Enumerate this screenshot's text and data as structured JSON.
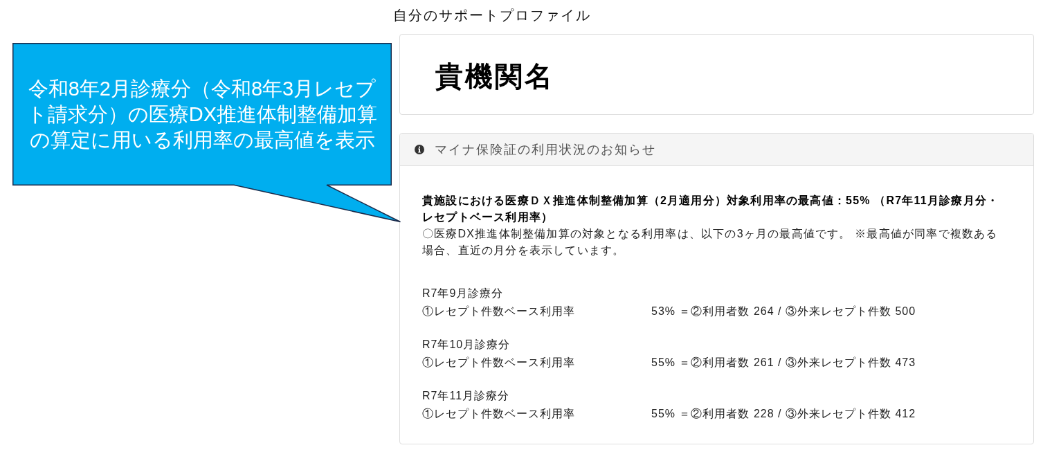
{
  "page_title": "自分のサポートプロファイル",
  "institution_card": {
    "name": "貴機関名"
  },
  "notice_panel": {
    "header": "マイナ保険証の利用状況のお知らせ",
    "headline": "貴施設における医療ＤＸ推進体制整備加算（2月適用分）対象利用率の最高値：55% （R7年11月診療月分・レセプトベース利用率）",
    "description": "〇医療DX推進体制整備加算の対象となる利用率は、以下の3ヶ月の最高値です。 ※最高値が同率で複数ある場合、直近の月分を表示しています。",
    "months": [
      {
        "period": "R7年9月診療分",
        "metric": "①レセプト件数ベース利用率",
        "value": "53% ＝②利用者数 264 / ③外来レセプト件数 500"
      },
      {
        "period": "R7年10月診療分",
        "metric": "①レセプト件数ベース利用率",
        "value": "55% ＝②利用者数 261 / ③外来レセプト件数 473"
      },
      {
        "period": "R7年11月診療分",
        "metric": "①レセプト件数ベース利用率",
        "value": "55% ＝②利用者数 228 / ③外来レセプト件数 412"
      }
    ]
  },
  "callout": {
    "text": "令和8年2月診療分（令和8年3月レセプト請求分）の医療DX推進体制整備加算の算定に用いる利用率の最高値を表示"
  }
}
